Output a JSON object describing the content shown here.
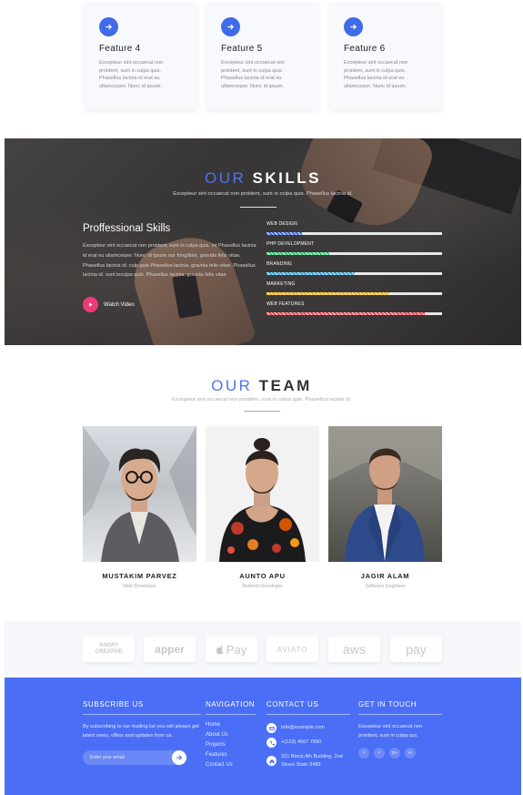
{
  "features": [
    {
      "title": "Feature 4",
      "text": "Excepteur sint occaecat non proident, sunt in culpa quis. Phasellus lacinia id erat eu ullamcorper. Nunc id ipsum."
    },
    {
      "title": "Feature 5",
      "text": "Excepteur sint occaecat non proident, sunt in culpa quis. Phasellus lacinia id erat eu ullamcorper. Nunc id ipsum."
    },
    {
      "title": "Feature 6",
      "text": "Excepteur sint occaecat non proident, sunt in culpa quis. Phasellus lacinia id erat eu ullamcorper. Nunc id ipsum."
    }
  ],
  "skills": {
    "title_part1": "OUR",
    "title_part2": "SKILLS",
    "subtitle": "Excepteur sint occaecat non proident, sunt in culpa quis. Phasellus lacinia id.",
    "heading": "Proffessional Skills",
    "text": "Excepteur sint occaecat non proident, sunt in culpa quis. int Phasellus lacinia id erat eu ullamcorper. Nunc id ipsum our fringillats, gravida felis vitae. Phasellus lacinia id. culp quis Phasellus lacinia. gravida felis vitae. Phasellus lacinia id. sunt inculpa quis. Phasellus lacinia. gravida felis vitae.",
    "watch_label": "Watch Video",
    "bars": [
      {
        "label": "WEB DESIGN",
        "percent": 20,
        "color": "#3f6ae8"
      },
      {
        "label": "PHP DEVELOPMENT",
        "percent": 36,
        "color": "#2ecc71"
      },
      {
        "label": "BRANDING",
        "percent": 50,
        "color": "#2da8dc"
      },
      {
        "label": "MARKETING",
        "percent": 70,
        "color": "#f5b400"
      },
      {
        "label": "WEB FEATURES",
        "percent": 90,
        "color": "#ee4450"
      }
    ]
  },
  "team": {
    "title_part1": "OUR",
    "title_part2": "TEAM",
    "subtitle": "Excepteur sint occaecat non proident, sunt in culpa quis. Phasellus lacinia id.",
    "members": [
      {
        "name": "MUSTAKIM PARVEZ",
        "role": "Web Developer"
      },
      {
        "name": "AUNTO APU",
        "role": "Android Developer"
      },
      {
        "name": "JAGIR ALAM",
        "role": "Software Engineer"
      }
    ]
  },
  "brands": [
    "ANGRY CREATIVE",
    "apper",
    "Pay",
    "AVIATO",
    "aws",
    "pay"
  ],
  "footer": {
    "subscribe": {
      "heading": "SUBSCRIBE US",
      "text": "By subscribing to our mailing list you will always get latest news, offers and updates from us.",
      "placeholder": "Enter your email"
    },
    "navigation": {
      "heading": "NAVIGATION",
      "links": [
        "Home",
        "About Us",
        "Projects",
        "Features",
        "Contact Us"
      ]
    },
    "contact": {
      "heading": "CONTACT US",
      "email": "info@example.com",
      "phone": "+(123) 4567 7890",
      "address": "321 Block,4th Building, 2nd Street State 3489."
    },
    "touch": {
      "heading": "GET IN TOUCH",
      "text": "Excepteur sint occaecat non proident, sunt in culpa qui.",
      "socials": [
        "f",
        "t",
        "G+",
        "in"
      ]
    }
  },
  "colors": {
    "accent": "#4a6ef5",
    "play": "#ee3a7a"
  }
}
